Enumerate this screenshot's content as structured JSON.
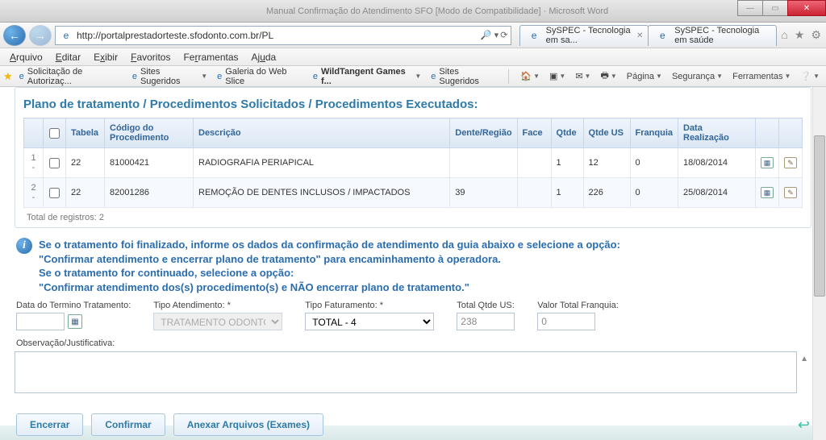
{
  "window": {
    "title": "Manual Confirmação do Atendimento SFO [Modo de Compatibilidade] · Microsoft Word"
  },
  "address": {
    "url": "http://portalprestadorteste.sfodonto.com.br/PL",
    "searchHint": ""
  },
  "tabs": [
    {
      "label": "SySPEC - Tecnologia em sa..."
    },
    {
      "label": "SySPEC - Tecnologia em saúde"
    }
  ],
  "menu": {
    "arquivo": "Arquivo",
    "editar": "Editar",
    "exibir": "Exibir",
    "favoritos": "Favoritos",
    "ferramentas": "Ferramentas",
    "ajuda": "Ajuda"
  },
  "links": {
    "solicitacao": "Solicitação de Autorizaç...",
    "sites": "Sites Sugeridos",
    "galeria": "Galeria do Web Slice",
    "wildtangent": "WildTangent Games f...",
    "sites2": "Sites Sugeridos"
  },
  "tools": {
    "pagina": "Página",
    "seguranca": "Segurança",
    "ferramentas": "Ferramentas"
  },
  "panelTitle": "Plano de tratamento / Procedimentos Solicitados / Procedimentos Executados:",
  "cols": {
    "tabela": "Tabela",
    "codigo": "Código do Procedimento",
    "descricao": "Descrição",
    "dente": "Dente/Região",
    "face": "Face",
    "qtde": "Qtde",
    "qtdeus": "Qtde US",
    "franquia": "Franquia",
    "data": "Data Realização"
  },
  "rows": [
    {
      "idx": "1 -",
      "tabela": "22",
      "codigo": "81000421",
      "descricao": "RADIOGRAFIA PERIAPICAL",
      "dente": "",
      "face": "",
      "qtde": "1",
      "qtdeus": "12",
      "franquia": "0",
      "data": "18/08/2014"
    },
    {
      "idx": "2 -",
      "tabela": "22",
      "codigo": "82001286",
      "descricao": "REMOÇÃO DE DENTES INCLUSOS / IMPACTADOS",
      "dente": "39",
      "face": "",
      "qtde": "1",
      "qtdeus": "226",
      "franquia": "0",
      "data": "25/08/2014"
    }
  ],
  "totalRegistros": "Total de registros: 2",
  "info": {
    "l1": "Se o tratamento foi finalizado, informe os dados da confirmação de atendimento da guia abaixo e selecione a opção:",
    "l2": "\"Confirmar atendimento e encerrar plano de tratamento\" para encaminhamento à operadora.",
    "l3": "Se o tratamento for continuado, selecione a opção:",
    "l4": "\"Confirmar atendimento dos(s) procedimento(s) e NÃO encerrar plano de tratamento.\""
  },
  "form": {
    "dataTermino": "Data do Termino Tratamento:",
    "tipoAtend": "Tipo Atendimento: *",
    "tipoAtendVal": "TRATAMENTO ODONTOLO",
    "tipoFat": "Tipo Faturamento: *",
    "tipoFatVal": "TOTAL - 4",
    "totQtde": "Total Qtde US:",
    "totQtdeVal": "238",
    "valFranq": "Valor Total Franquia:",
    "valFranqVal": "0",
    "obs": "Observação/Justificativa:"
  },
  "buttons": {
    "encerrar": "Encerrar",
    "confirmar": "Confirmar",
    "anexar": "Anexar Arquivos (Exames)"
  }
}
